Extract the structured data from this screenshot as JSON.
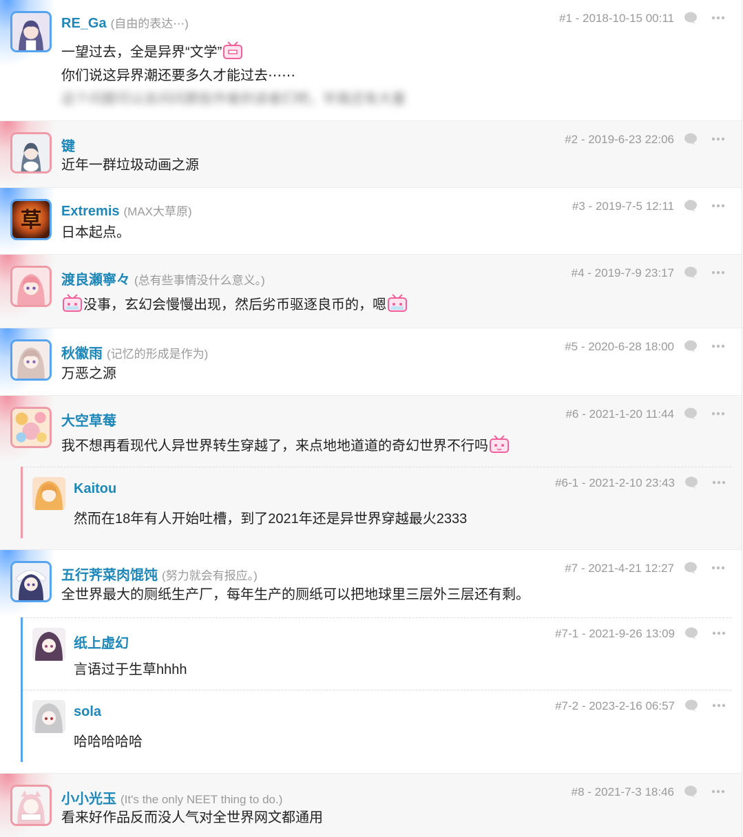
{
  "comments": [
    {
      "user": "RE_Ga",
      "signature": "(自由的表达⋯)",
      "floor": "#1",
      "date": "2018-10-15 00:11",
      "lines": [
        "一望过去，全是异界“文学”",
        "你们说这异界潮还要多久才能过去⋯⋯"
      ],
      "blurred": "这个问题可以去问问那些作者的读者们吧，毕竟还有大量"
    },
    {
      "user": "键",
      "signature": "",
      "floor": "#2",
      "date": "2019-6-23 22:06",
      "text": "近年一群垃圾动画之源"
    },
    {
      "user": "Extremis",
      "signature": "(MAX大草原)",
      "floor": "#3",
      "date": "2019-7-5 12:11",
      "text": "日本起点。",
      "avatar_glyph": "草"
    },
    {
      "user": "渡良瀬寧々",
      "signature": "(总有些事情没什么意义。)",
      "floor": "#4",
      "date": "2019-7-9 23:17",
      "text": "没事，玄幻会慢慢出现，然后劣币驱逐良币的，嗯"
    },
    {
      "user": "秋徽雨",
      "signature": "(记忆的形成是作为)",
      "floor": "#5",
      "date": "2020-6-28 18:00",
      "text": "万恶之源"
    },
    {
      "user": "大空草莓",
      "signature": "",
      "floor": "#6",
      "date": "2021-1-20 11:44",
      "text": "我不想再看现代人异世界转生穿越了，来点地地道道的奇幻世界不行吗",
      "replies": [
        {
          "user": "Kaitou",
          "floor": "#6-1",
          "date": "2021-2-10 23:43",
          "text": "然而在18年有人开始吐槽，到了2021年还是异世界穿越最火2333"
        }
      ]
    },
    {
      "user": "五行荠菜肉馄饨",
      "signature": "(努力就会有报应。)",
      "floor": "#7",
      "date": "2021-4-21 12:27",
      "text": "全世界最大的厕纸生产厂，每年生产的厕纸可以把地球里三层外三层还有剩。",
      "replies": [
        {
          "user": "纸上虚幻",
          "floor": "#7-1",
          "date": "2021-9-26 13:09",
          "text": "言语过于生草hhhh"
        },
        {
          "user": "sola",
          "floor": "#7-2",
          "date": "2023-2-16 06:57",
          "text": "哈哈哈哈哈"
        }
      ]
    },
    {
      "user": "小小光玉",
      "signature": "(It's the only NEET thing to do.)",
      "floor": "#8",
      "date": "2021-7-3 18:46",
      "text": "看来好作品反而没人气对全世界网文都通用"
    }
  ],
  "colors": {
    "username": "#1c87b8",
    "meta": "#9a9a9a",
    "blue_accent": "#56a4f0",
    "pink_accent": "#ef9aa7",
    "emoji_pink": "#f0609a"
  },
  "icons": {
    "reply": "speech-bubble-icon",
    "more": "more-dots-icon",
    "emoji": "bilibili-tv-emoji"
  }
}
